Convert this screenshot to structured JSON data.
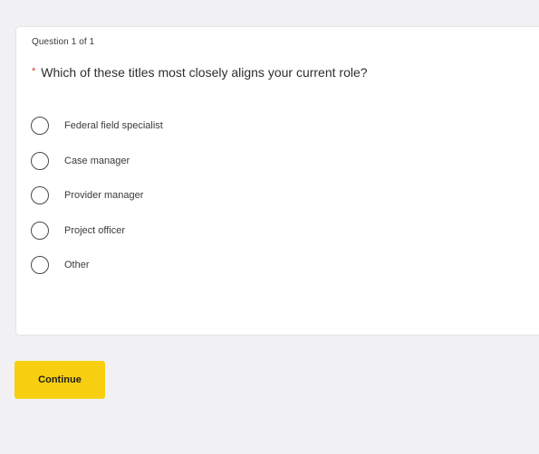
{
  "survey": {
    "counter": "Question 1 of 1",
    "required_marker": "*",
    "question": "Which of these titles most closely aligns your current role?",
    "options": [
      {
        "label": "Federal field specialist",
        "selected": false
      },
      {
        "label": "Case manager",
        "selected": false
      },
      {
        "label": "Provider manager",
        "selected": false
      },
      {
        "label": "Project officer",
        "selected": false
      },
      {
        "label": "Other",
        "selected": false
      }
    ]
  },
  "actions": {
    "continue_label": "Continue"
  },
  "colors": {
    "background": "#f1f1f3",
    "card": "#ffffff",
    "required": "#d0342c",
    "button": "#f7cf10"
  }
}
